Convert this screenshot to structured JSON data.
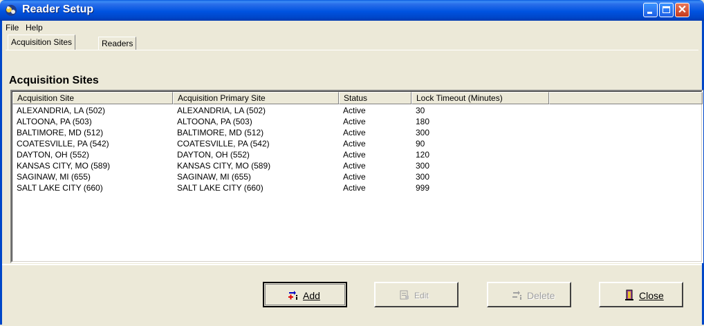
{
  "window": {
    "title": "Reader Setup"
  },
  "menu": [
    "File",
    "Help"
  ],
  "tabs": [
    {
      "label": "Acquisition Sites",
      "active": true
    },
    {
      "label": "Readers",
      "active": false
    }
  ],
  "section_heading": "Acquisition Sites",
  "table": {
    "columns": [
      "Acquisition Site",
      "Acquisition Primary Site",
      "Status",
      "Lock Timeout (Minutes)"
    ],
    "rows": [
      [
        "ALEXANDRIA, LA (502)",
        "ALEXANDRIA, LA (502)",
        "Active",
        "30"
      ],
      [
        "ALTOONA, PA (503)",
        "ALTOONA, PA (503)",
        "Active",
        "180"
      ],
      [
        "BALTIMORE, MD (512)",
        "BALTIMORE, MD (512)",
        "Active",
        "300"
      ],
      [
        "COATESVILLE, PA (542)",
        "COATESVILLE, PA (542)",
        "Active",
        "90"
      ],
      [
        "DAYTON, OH (552)",
        "DAYTON, OH (552)",
        "Active",
        "120"
      ],
      [
        "KANSAS CITY, MO (589)",
        "KANSAS CITY, MO (589)",
        "Active",
        "300"
      ],
      [
        "SAGINAW, MI (655)",
        "SAGINAW, MI (655)",
        "Active",
        "300"
      ],
      [
        "SALT LAKE CITY (660)",
        "SALT LAKE CITY (660)",
        "Active",
        "999"
      ]
    ]
  },
  "buttons": {
    "add": {
      "label": "Add",
      "enabled": true,
      "icon": "add-icon"
    },
    "edit": {
      "label": "Edit",
      "enabled": false,
      "icon": "edit-icon"
    },
    "delete": {
      "label": "Delete",
      "enabled": false,
      "icon": "delete-icon"
    },
    "close": {
      "label": "Close",
      "enabled": true,
      "icon": "door-icon"
    }
  },
  "colors": {
    "titlebar": "#0053E0",
    "face": "#ECE9D8",
    "close_button": "#C4391C"
  }
}
